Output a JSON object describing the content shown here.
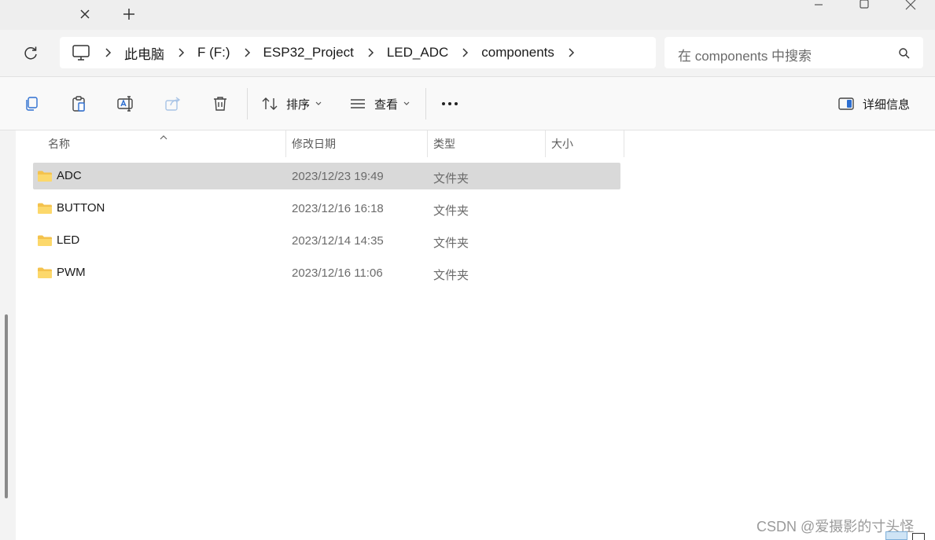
{
  "titlebar": {
    "close_tab_icon": "close-icon",
    "new_tab_icon": "plus-icon",
    "window_controls": [
      "minimize-icon",
      "maximize-icon",
      "close-icon"
    ]
  },
  "address": {
    "refresh_icon": "refresh-icon",
    "pc_icon": "computer-icon",
    "segments": [
      "此电脑",
      "F (F:)",
      "ESP32_Project",
      "LED_ADC",
      "components"
    ]
  },
  "search": {
    "placeholder": "在 components 中搜索",
    "icon": "search-icon"
  },
  "toolbar": {
    "icons": [
      "copy-icon",
      "paste-icon",
      "rename-icon",
      "share-icon",
      "delete-icon"
    ],
    "sort_label": "排序",
    "view_label": "查看",
    "more_icon": "more-icon",
    "details_label": "详细信息"
  },
  "columns": {
    "name": "名称",
    "date": "修改日期",
    "type": "类型",
    "size": "大小"
  },
  "files": [
    {
      "name": "ADC",
      "date": "2023/12/23 19:49",
      "type": "文件夹",
      "selected": true
    },
    {
      "name": "BUTTON",
      "date": "2023/12/16 16:18",
      "type": "文件夹",
      "selected": false
    },
    {
      "name": "LED",
      "date": "2023/12/14 14:35",
      "type": "文件夹",
      "selected": false
    },
    {
      "name": "PWM",
      "date": "2023/12/16 11:06",
      "type": "文件夹",
      "selected": false
    }
  ],
  "watermark": "CSDN @爱摄影的寸头怪",
  "colors": {
    "selection": "#d9d9d9",
    "folder": "#f4c24c"
  }
}
